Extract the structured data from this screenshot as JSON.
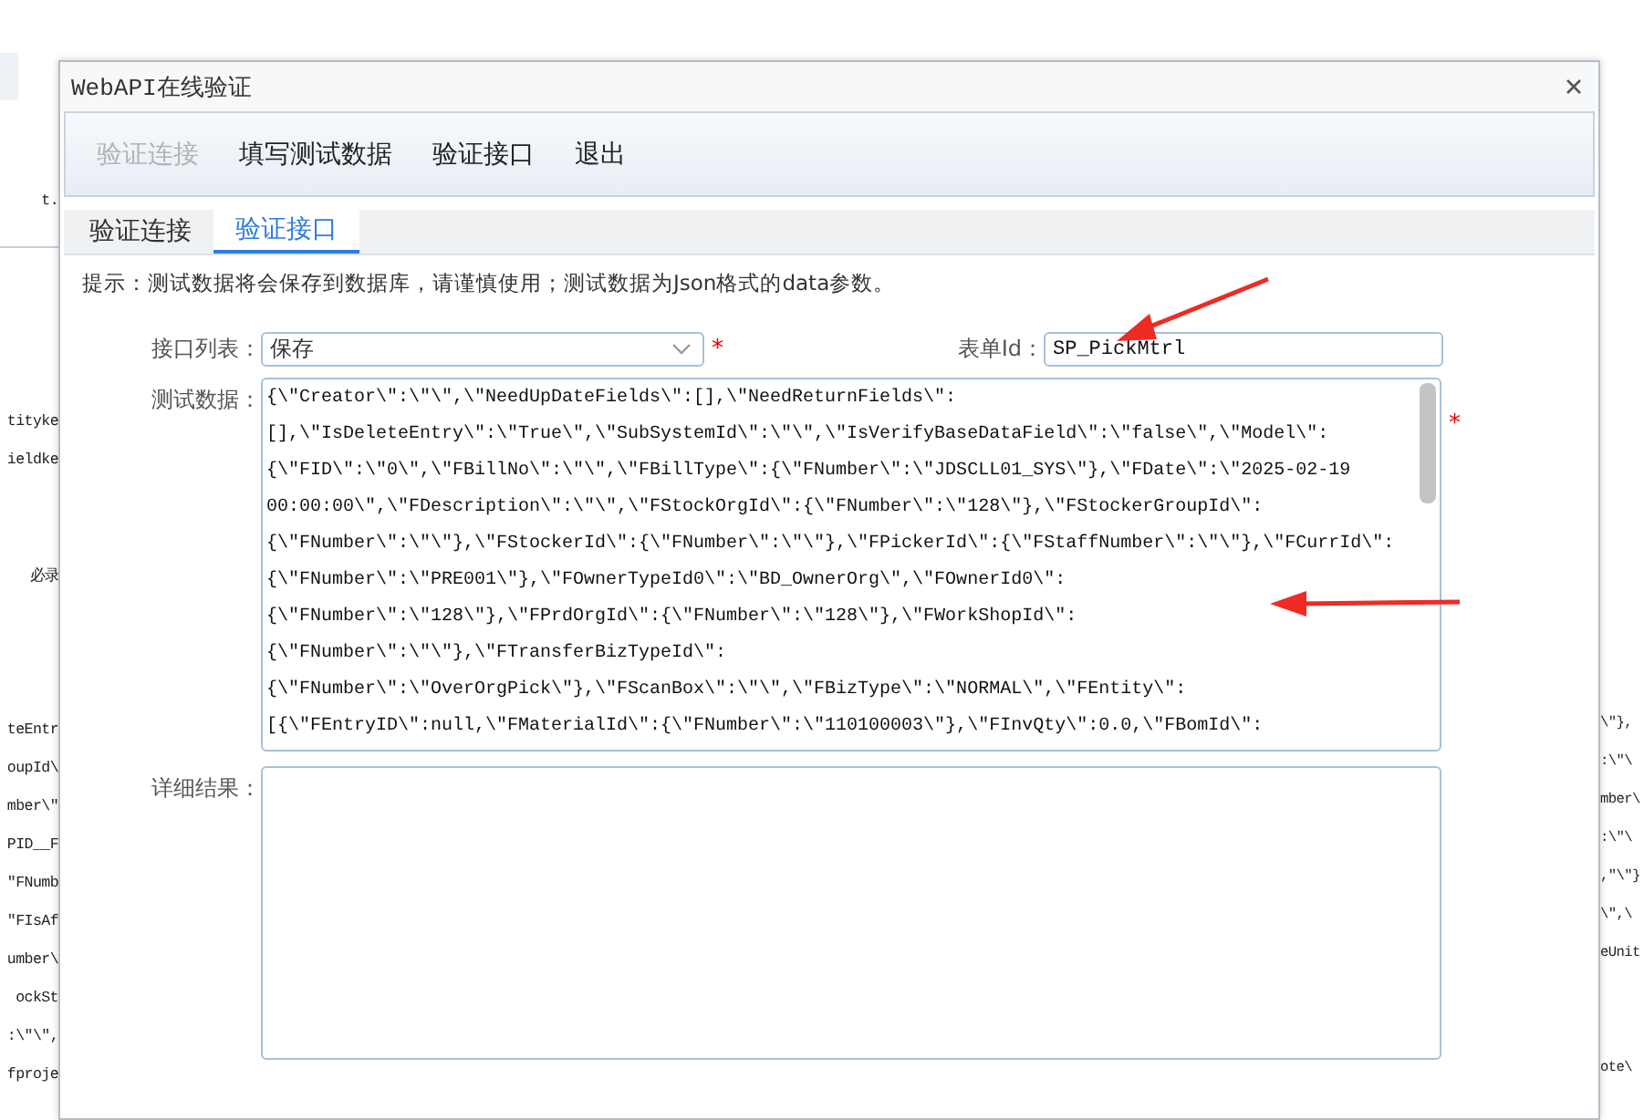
{
  "background": {
    "left_groups": [
      [
        "t."
      ],
      [
        "tityke",
        "ieldke"
      ],
      [
        "必录"
      ],
      [
        "teEntr",
        "oupId\\",
        "mber\\\"",
        "PID__F",
        "\"FNumb",
        "\"FIsAf",
        "umber\\",
        "ockSt",
        ":\\\"\\\",",
        "fproje"
      ]
    ],
    "right_groups": [
      [
        "\\\"},",
        ":\\\"\\",
        "mber\\",
        ":\\\"\\",
        ",\"\\\"}",
        "\\\",\\",
        "eUnit"
      ],
      [
        "ote\\"
      ]
    ]
  },
  "window": {
    "title": "WebAPI在线验证"
  },
  "toolbar": [
    {
      "label": "验证连接",
      "disabled": true
    },
    {
      "label": "填写测试数据",
      "disabled": false
    },
    {
      "label": "验证接口",
      "disabled": false
    },
    {
      "label": "退出",
      "disabled": false
    }
  ],
  "tabs": [
    {
      "label": "验证连接",
      "selected": false
    },
    {
      "label": "验证接口",
      "selected": true
    }
  ],
  "hint": "提示：测试数据将会保存到数据库，请谨慎使用；测试数据为Json格式的data参数。",
  "required_mark": "*",
  "interface_list": {
    "label": "接口列表：",
    "value": "保存",
    "required": true
  },
  "form_id": {
    "label": "表单Id：",
    "value": "SP_PickMtrl"
  },
  "test_data": {
    "label": "测试数据：",
    "required": true,
    "lines": [
      "{\\\"Creator\\\":\\\"\\\",\\\"NeedUpDateFields\\\":[],\\\"NeedReturnFields\\\":",
      "[],\\\"IsDeleteEntry\\\":\\\"True\\\",\\\"SubSystemId\\\":\\\"\\\",\\\"IsVerifyBaseDataField\\\":\\\"false\\\",\\\"Model\\\":",
      "{\\\"FID\\\":\\\"0\\\",\\\"FBillNo\\\":\\\"\\\",\\\"FBillType\\\":{\\\"FNumber\\\":\\\"JDSCLL01_SYS\\\"},\\\"FDate\\\":\\\"2025-02-19",
      "00:00:00\\\",\\\"FDescription\\\":\\\"\\\",\\\"FStockOrgId\\\":{\\\"FNumber\\\":\\\"128\\\"},\\\"FStockerGroupId\\\":",
      "{\\\"FNumber\\\":\\\"\\\"},\\\"FStockerId\\\":{\\\"FNumber\\\":\\\"\\\"},\\\"FPickerId\\\":{\\\"FStaffNumber\\\":\\\"\\\"},\\\"FCurrId\\\":",
      "{\\\"FNumber\\\":\\\"PRE001\\\"},\\\"FOwnerTypeId0\\\":\\\"BD_OwnerOrg\\\",\\\"FOwnerId0\\\":",
      "{\\\"FNumber\\\":\\\"128\\\"},\\\"FPrdOrgId\\\":{\\\"FNumber\\\":\\\"128\\\"},\\\"FWorkShopId\\\":",
      "{\\\"FNumber\\\":\\\"\\\"},\\\"FTransferBizTypeId\\\":",
      "{\\\"FNumber\\\":\\\"OverOrgPick\\\"},\\\"FScanBox\\\":\\\"\\\",\\\"FBizType\\\":\\\"NORMAL\\\",\\\"FEntity\\\":",
      "[{\\\"FEntryID\\\":null,\\\"FMaterialId\\\":{\\\"FNumber\\\":\\\"110100003\\\"},\\\"FInvQty\\\":0.0,\\\"FBomId\\\":"
    ]
  },
  "result": {
    "label": "详细结果："
  }
}
